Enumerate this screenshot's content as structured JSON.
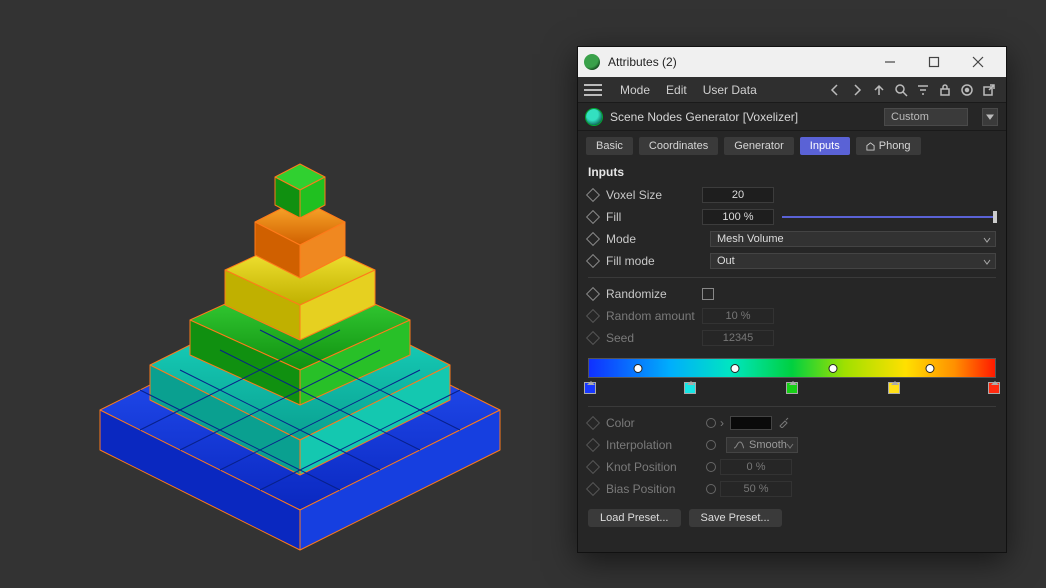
{
  "window": {
    "title": "Attributes (2)"
  },
  "menu": {
    "mode": "Mode",
    "edit": "Edit",
    "userdata": "User Data"
  },
  "node": {
    "name": "Scene Nodes Generator [Voxelizer]",
    "preset": "Custom"
  },
  "tabs": {
    "basic": "Basic",
    "coord": "Coordinates",
    "gen": "Generator",
    "inputs": "Inputs",
    "phong": "Phong"
  },
  "section": {
    "heading": "Inputs"
  },
  "params": {
    "voxel_size": {
      "label": "Voxel Size",
      "value": "20"
    },
    "fill": {
      "label": "Fill",
      "value": "100 %"
    },
    "mode": {
      "label": "Mode",
      "value": "Mesh Volume"
    },
    "fillmode": {
      "label": "Fill mode",
      "value": "Out"
    },
    "randomize": {
      "label": "Randomize"
    },
    "random_amt": {
      "label": "Random amount",
      "value": "10 %"
    },
    "seed": {
      "label": "Seed",
      "value": "12345"
    },
    "color": {
      "label": "Color"
    },
    "interp": {
      "label": "Interpolation",
      "value": "Smooth"
    },
    "knot": {
      "label": "Knot Position",
      "value": "0 %"
    },
    "bias": {
      "label": "Bias Position",
      "value": "50 %"
    }
  },
  "gradient": {
    "knots_pct": [
      12,
      36,
      60,
      84
    ],
    "stops": [
      {
        "pos": 0.5,
        "color": "#1838ff"
      },
      {
        "pos": 25,
        "color": "#18e6e6"
      },
      {
        "pos": 50,
        "color": "#18d018"
      },
      {
        "pos": 75,
        "color": "#ffe018"
      },
      {
        "pos": 99.5,
        "color": "#ff2a10"
      }
    ]
  },
  "buttons": {
    "load": "Load Preset...",
    "save": "Save Preset..."
  }
}
